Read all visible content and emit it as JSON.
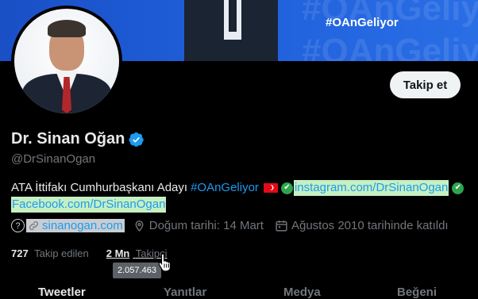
{
  "banner": {
    "hashtag": "#OAnGeliyor",
    "watermark": "#OAnGeliyor"
  },
  "profile": {
    "name": "Dr. Sinan Oğan",
    "handle": "@DrSinanOgan",
    "follow_label": "Takip et",
    "verified_icon": "verified-badge-icon"
  },
  "bio": {
    "text": "ATA İttifakı Cumhurbaşkanı Adayı",
    "hashtag": "#OAnGeliyor",
    "instagram": "instagram.com/DrSinanOgan",
    "facebook": "Facebook.com/DrSinanOgan"
  },
  "meta": {
    "website": "sinanogan.com",
    "birthday": "Doğum tarihi: 14 Mart",
    "joined": "Ağustos 2010 tarihinde katıldı"
  },
  "stats": {
    "following_count": "727",
    "following_label": "Takip edilen",
    "followers_count": "2 Mn",
    "followers_label": "Takipçi",
    "followers_tooltip": "2.057.463"
  },
  "tabs": [
    "Tweetler",
    "Yanıtlar",
    "Medya",
    "Beğeni"
  ],
  "colors": {
    "accent": "#1d9bf0",
    "background": "#000000",
    "secondary_text": "#71767b"
  }
}
